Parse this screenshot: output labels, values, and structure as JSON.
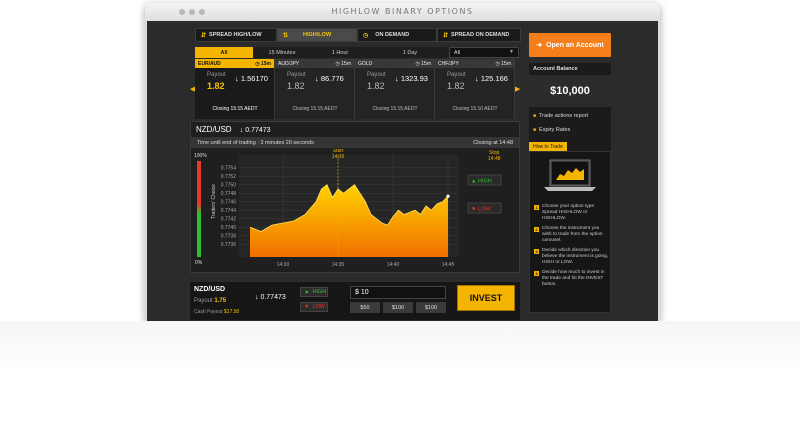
{
  "window": {
    "title": "HIGHLOW BINARY OPTIONS"
  },
  "nav": {
    "tabs": [
      {
        "label": "SPREAD HIGH/LOW",
        "icon": "spread-icon",
        "active": false
      },
      {
        "label": "HIGH/LOW",
        "icon": "updown-arrows-icon",
        "active": true
      },
      {
        "label": "ON DEMAND",
        "icon": "clock-icon",
        "active": false
      },
      {
        "label": "SPREAD ON DEMAND",
        "icon": "spread-icon",
        "active": false
      }
    ]
  },
  "filters": {
    "tabs": [
      "All",
      "15 Minutes",
      "1 Hour",
      "1 Day"
    ],
    "active": "All",
    "select_value": "All"
  },
  "assets": [
    {
      "pair": "EUR/AUD",
      "duration": "15m",
      "payout_label": "Payout",
      "payout": "1.82",
      "rate": "1.56170",
      "direction": "down",
      "closing": "Closing 15:15 AEDT",
      "active": true
    },
    {
      "pair": "AUD/JPY",
      "duration": "15m",
      "payout_label": "Payout",
      "payout": "1.82",
      "rate": "86.776",
      "direction": "down",
      "closing": "Closing 15:15 AEDT",
      "active": false
    },
    {
      "pair": "GOLD",
      "duration": "15m",
      "payout_label": "Payout",
      "payout": "1.82",
      "rate": "1323.93",
      "direction": "down",
      "closing": "Closing 15:15 AEDT",
      "active": false
    },
    {
      "pair": "CHF/JPY",
      "duration": "15m",
      "payout_label": "Payout",
      "payout": "1.82",
      "rate": "125.166",
      "direction": "down",
      "closing": "Closing 15:10 AEDT",
      "active": false
    }
  ],
  "chart_panel": {
    "pair": "NZD/USD",
    "rate": "0.77473",
    "time_left": "Time until end of trading : 3 minutes 20 seconds",
    "closing_at": "Closing at 14:48",
    "high_label": "HIGH",
    "low_label": "LOW",
    "traders_choice_label": "Traders' Choice",
    "traders_top": "100%",
    "traders_bottom": "0%",
    "start_label": "Start",
    "start_time": "14:35",
    "stop_label": "Stop",
    "stop_time": "14:48"
  },
  "chart_data": {
    "type": "area",
    "ylim": [
      0.7733,
      0.7757
    ],
    "yticks": [
      "0.7754",
      "0.7752",
      "0.7750",
      "0.7748",
      "0.7746",
      "0.7744",
      "0.7742",
      "0.7740",
      "0.7738",
      "0.7736"
    ],
    "xticks": [
      "14:30",
      "14:35",
      "14:40",
      "14:45"
    ],
    "x_range": [
      "14:26",
      "14:46"
    ],
    "series": [
      {
        "x": [
          "14:27",
          "14:28",
          "14:29",
          "14:30",
          "14:31",
          "14:32",
          "14:33",
          "14:33:30",
          "14:34",
          "14:34:30",
          "14:35",
          "14:35:30",
          "14:36",
          "14:36:30",
          "14:37",
          "14:37:30",
          "14:38",
          "14:38:30",
          "14:39",
          "14:39:30",
          "14:40",
          "14:40:30",
          "14:41",
          "14:41:30",
          "14:42",
          "14:42:30",
          "14:43",
          "14:43:30",
          "14:44",
          "14:44:30",
          "14:45"
        ],
        "values": [
          0.774,
          0.7739,
          0.77405,
          0.7741,
          0.77415,
          0.7743,
          0.7746,
          0.7749,
          0.775,
          0.7747,
          0.7749,
          0.7748,
          0.7749,
          0.775,
          0.7748,
          0.7746,
          0.7743,
          0.7742,
          0.7741,
          0.77405,
          0.77425,
          0.7744,
          0.7743,
          0.77435,
          0.7744,
          0.7743,
          0.7745,
          0.7744,
          0.77455,
          0.7746,
          0.77473
        ]
      }
    ],
    "start_marker": "14:35",
    "grid": true
  },
  "bottom": {
    "pair": "NZD/USD",
    "payout_label": "Payout",
    "payout": "1.75",
    "rate": "0.77473",
    "cash_label": "Cash Payout",
    "cash_value": "$17.50",
    "high_label": "HIGH",
    "low_label": "LOW",
    "amount": "$ 10",
    "presets": [
      "$50",
      "$100",
      "$100"
    ],
    "invest_label": "INVEST"
  },
  "sidebar": {
    "open_account_label": "Open an Account",
    "balance_label": "Account Balance",
    "balance": "$10,000",
    "links": [
      "Trade actions report",
      "Expiry Rates"
    ],
    "how_to_label": "How to Trade",
    "steps": [
      "Choose your option type Spread HIGHLOW or HIGHLOW.",
      "Choose the instrument you wish to trade from the option carousel.",
      "Decide which direction you believe the instrument is going, HIGH or LOW.",
      "Decide how much to invest in the trade and hit the INVEST button."
    ]
  },
  "colors": {
    "accent": "#f5b400",
    "orange": "#f57f1a",
    "panel": "#2b2b2b",
    "up": "#2fbf2f",
    "down": "#e53a2a"
  }
}
